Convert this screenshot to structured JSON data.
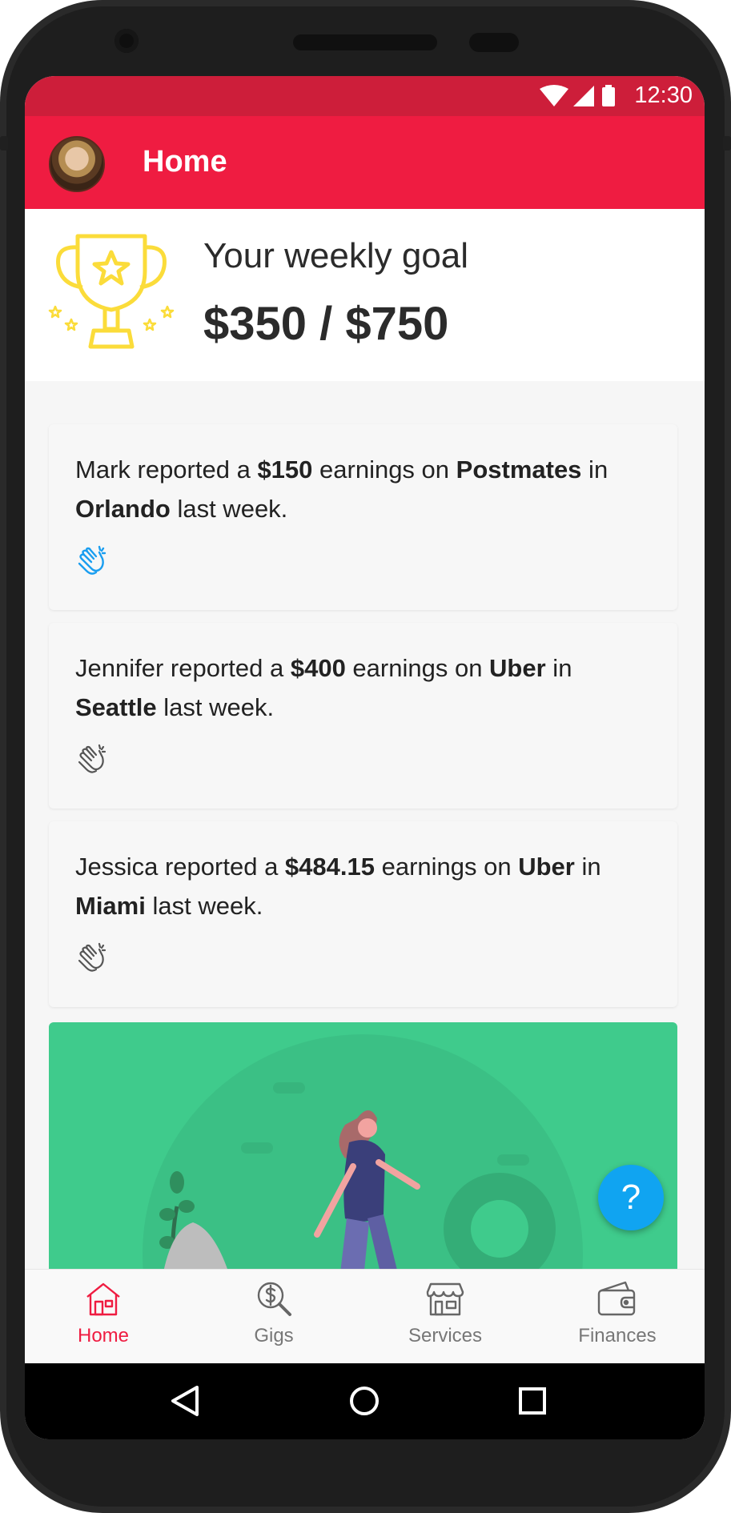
{
  "status": {
    "time": "12:30"
  },
  "appbar": {
    "title": "Home"
  },
  "goal": {
    "label": "Your weekly goal",
    "amount": "$350 / $750"
  },
  "feed": [
    {
      "name": "Mark",
      "verb": " reported a ",
      "amount": "$150",
      "mid": " earnings on ",
      "platform": "Postmates",
      "in": " in ",
      "city": "Orlando",
      "tail": " last week.",
      "liked": true
    },
    {
      "name": "Jennifer",
      "verb": " reported a ",
      "amount": "$400",
      "mid": " earnings on ",
      "platform": "Uber",
      "in": " in ",
      "city": "Seattle",
      "tail": " last week.",
      "liked": false
    },
    {
      "name": "Jessica",
      "verb": " reported a ",
      "amount": "$484.15",
      "mid": " earnings on ",
      "platform": "Uber",
      "in": " in ",
      "city": "Miami",
      "tail": " last week.",
      "liked": false
    }
  ],
  "fab": {
    "label": "?"
  },
  "nav": {
    "items": [
      {
        "label": "Home",
        "icon": "house-icon",
        "active": true
      },
      {
        "label": "Gigs",
        "icon": "dollar-search-icon",
        "active": false
      },
      {
        "label": "Services",
        "icon": "storefront-icon",
        "active": false
      },
      {
        "label": "Finances",
        "icon": "wallet-icon",
        "active": false
      }
    ]
  },
  "colors": {
    "primary": "#ef1c41",
    "statusbar": "#cd1e3a",
    "banner": "#3fcb8c",
    "fab": "#10a4f1",
    "trophy": "#fbdc3a",
    "clap_active": "#1a9ef0"
  }
}
